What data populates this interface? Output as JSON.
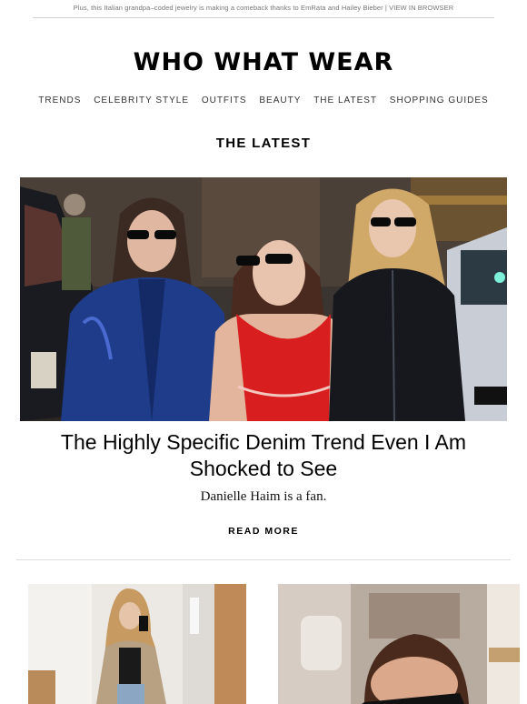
{
  "preheader": {
    "text": "Plus, this Italian grandpa–coded jewelry is making a comeback thanks to EmRata and Hailey Bieber",
    "separator": " | ",
    "view_in_browser": "VIEW IN BROWSER"
  },
  "brand": {
    "logo": "WHO WHAT WEAR"
  },
  "nav": {
    "items": [
      "TRENDS",
      "CELEBRITY STYLE",
      "OUTFITS",
      "BEAUTY",
      "THE LATEST",
      "SHOPPING GUIDES"
    ]
  },
  "section": {
    "title": "THE LATEST"
  },
  "hero": {
    "title": "The Highly Specific Denim Trend Even I Am Shocked to See",
    "dek": "Danielle Haim is a fan.",
    "cta": "READ MORE",
    "image_credit": "©"
  },
  "colors": {
    "text": "#111111",
    "muted": "#777777",
    "rule": "#cfcfcf",
    "jacket_blue": "#1e3c8a",
    "top_red": "#d81e1e"
  }
}
